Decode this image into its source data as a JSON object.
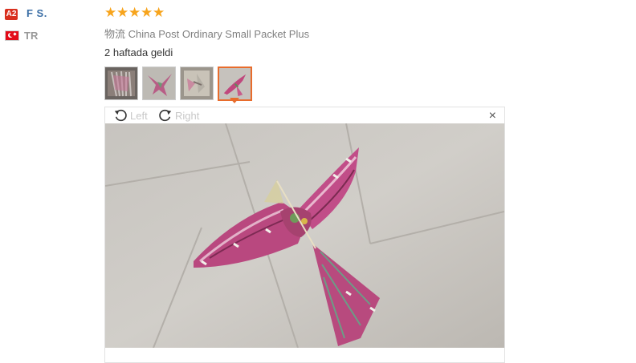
{
  "reviewer": {
    "level_badge": "A2",
    "name": "F S.",
    "country_code": "TR",
    "flag_icon": "turkey-flag-icon"
  },
  "review": {
    "rating": 5,
    "rating_max": 5,
    "star_color": "#f7a41c",
    "shipping_label": "物流",
    "shipping_method": "China Post Ordinary Small Packet Plus",
    "text": "2 haftada geldi"
  },
  "thumbnails": [
    {
      "name": "review-photo-1",
      "active": false
    },
    {
      "name": "review-photo-2",
      "active": false
    },
    {
      "name": "review-photo-3",
      "active": false
    },
    {
      "name": "review-photo-4",
      "active": true
    }
  ],
  "viewer": {
    "rotate_left_label": "Left",
    "rotate_right_label": "Right",
    "close_glyph": "×",
    "accent_color": "#e86c2c"
  }
}
